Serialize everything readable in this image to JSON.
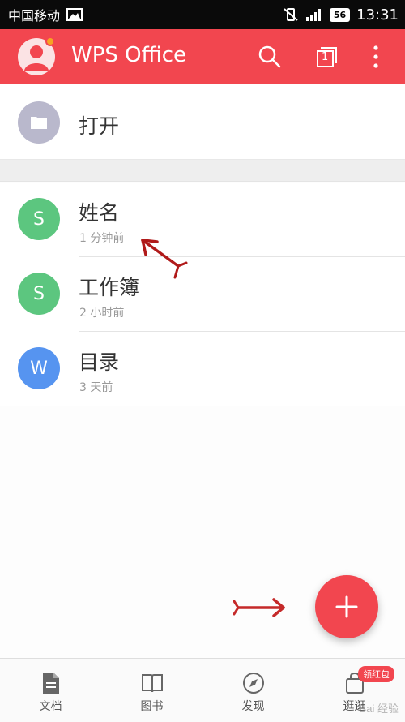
{
  "status_bar": {
    "carrier": "中国移动",
    "battery": "56",
    "time": "13:31"
  },
  "app_bar": {
    "title": "WPS Office",
    "tab_count": "1"
  },
  "open_row": {
    "label": "打开"
  },
  "files": [
    {
      "icon_letter": "S",
      "name": "姓名",
      "time": "1 分钟前",
      "color": "#5cc67f"
    },
    {
      "icon_letter": "S",
      "name": "工作簿",
      "time": "2 小时前",
      "color": "#5cc67f"
    },
    {
      "icon_letter": "W",
      "name": "目录",
      "time": "3 天前",
      "color": "#5694f0"
    }
  ],
  "bottom_nav": {
    "items": [
      {
        "label": "文档",
        "icon": "document-icon"
      },
      {
        "label": "图书",
        "icon": "book-icon"
      },
      {
        "label": "发现",
        "icon": "compass-icon"
      },
      {
        "label": "逛逛",
        "icon": "shopping-bag-icon"
      }
    ],
    "badge": "领红包"
  },
  "colors": {
    "brand": "#f2464f",
    "sheet": "#5cc67f",
    "doc": "#5694f0",
    "folder": "#b9b8cc"
  },
  "watermark": "Bai 经验"
}
